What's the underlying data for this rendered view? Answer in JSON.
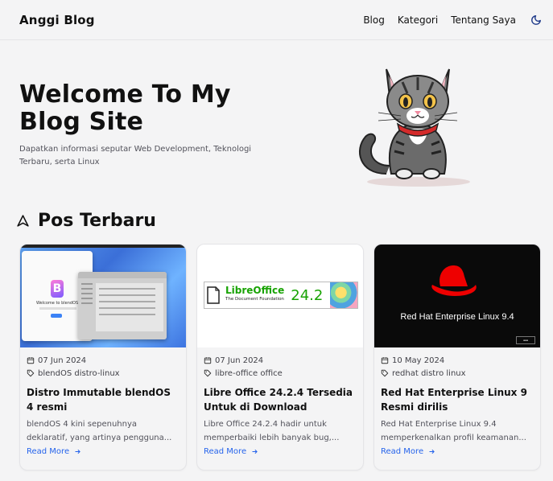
{
  "nav": {
    "brand": "Anggi Blog",
    "links": [
      "Blog",
      "Kategori",
      "Tentang Saya"
    ],
    "theme_icon": "moon-icon"
  },
  "hero": {
    "title": "Welcome To My Blog Site",
    "description": "Dapatkan informasi seputar Web Development, Teknologi Terbaru, serta Linux"
  },
  "section": {
    "icon": "paper-plane-icon",
    "title": "Pos Terbaru"
  },
  "posts": [
    {
      "date": "07 Jun 2024",
      "tags": "blendOS distro-linux",
      "title": "Distro Immutable blendOS 4 resmi",
      "excerpt": "blendOS 4 kini sepenuhnya deklaratif, yang artinya pengguna...",
      "read_more": "Read More",
      "thumb_text": "Welcome to blendOS"
    },
    {
      "date": "07 Jun 2024",
      "tags": "libre-office office",
      "title": "Libre Office 24.2.4 Tersedia Untuk di Download",
      "excerpt": "Libre Office 24.2.4 hadir untuk memperbaiki lebih banyak bug,...",
      "read_more": "Read More",
      "thumb_brand": "LibreOffice",
      "thumb_sub": "The Document Foundation",
      "thumb_version": "24.2"
    },
    {
      "date": "10 May 2024",
      "tags": "redhat distro linux",
      "title": "Red Hat Enterprise Linux 9 Resmi dirilis",
      "excerpt": "Red Hat Enterprise Linux 9.4 memperkenalkan profil keamanan...",
      "read_more": "Read More",
      "thumb_text": "Red Hat Enterprise Linux 9.4"
    }
  ],
  "colors": {
    "accent": "#2563eb",
    "background": "#f4f4f5",
    "libreoffice_green": "#18a303",
    "redhat_red": "#ee0000"
  }
}
